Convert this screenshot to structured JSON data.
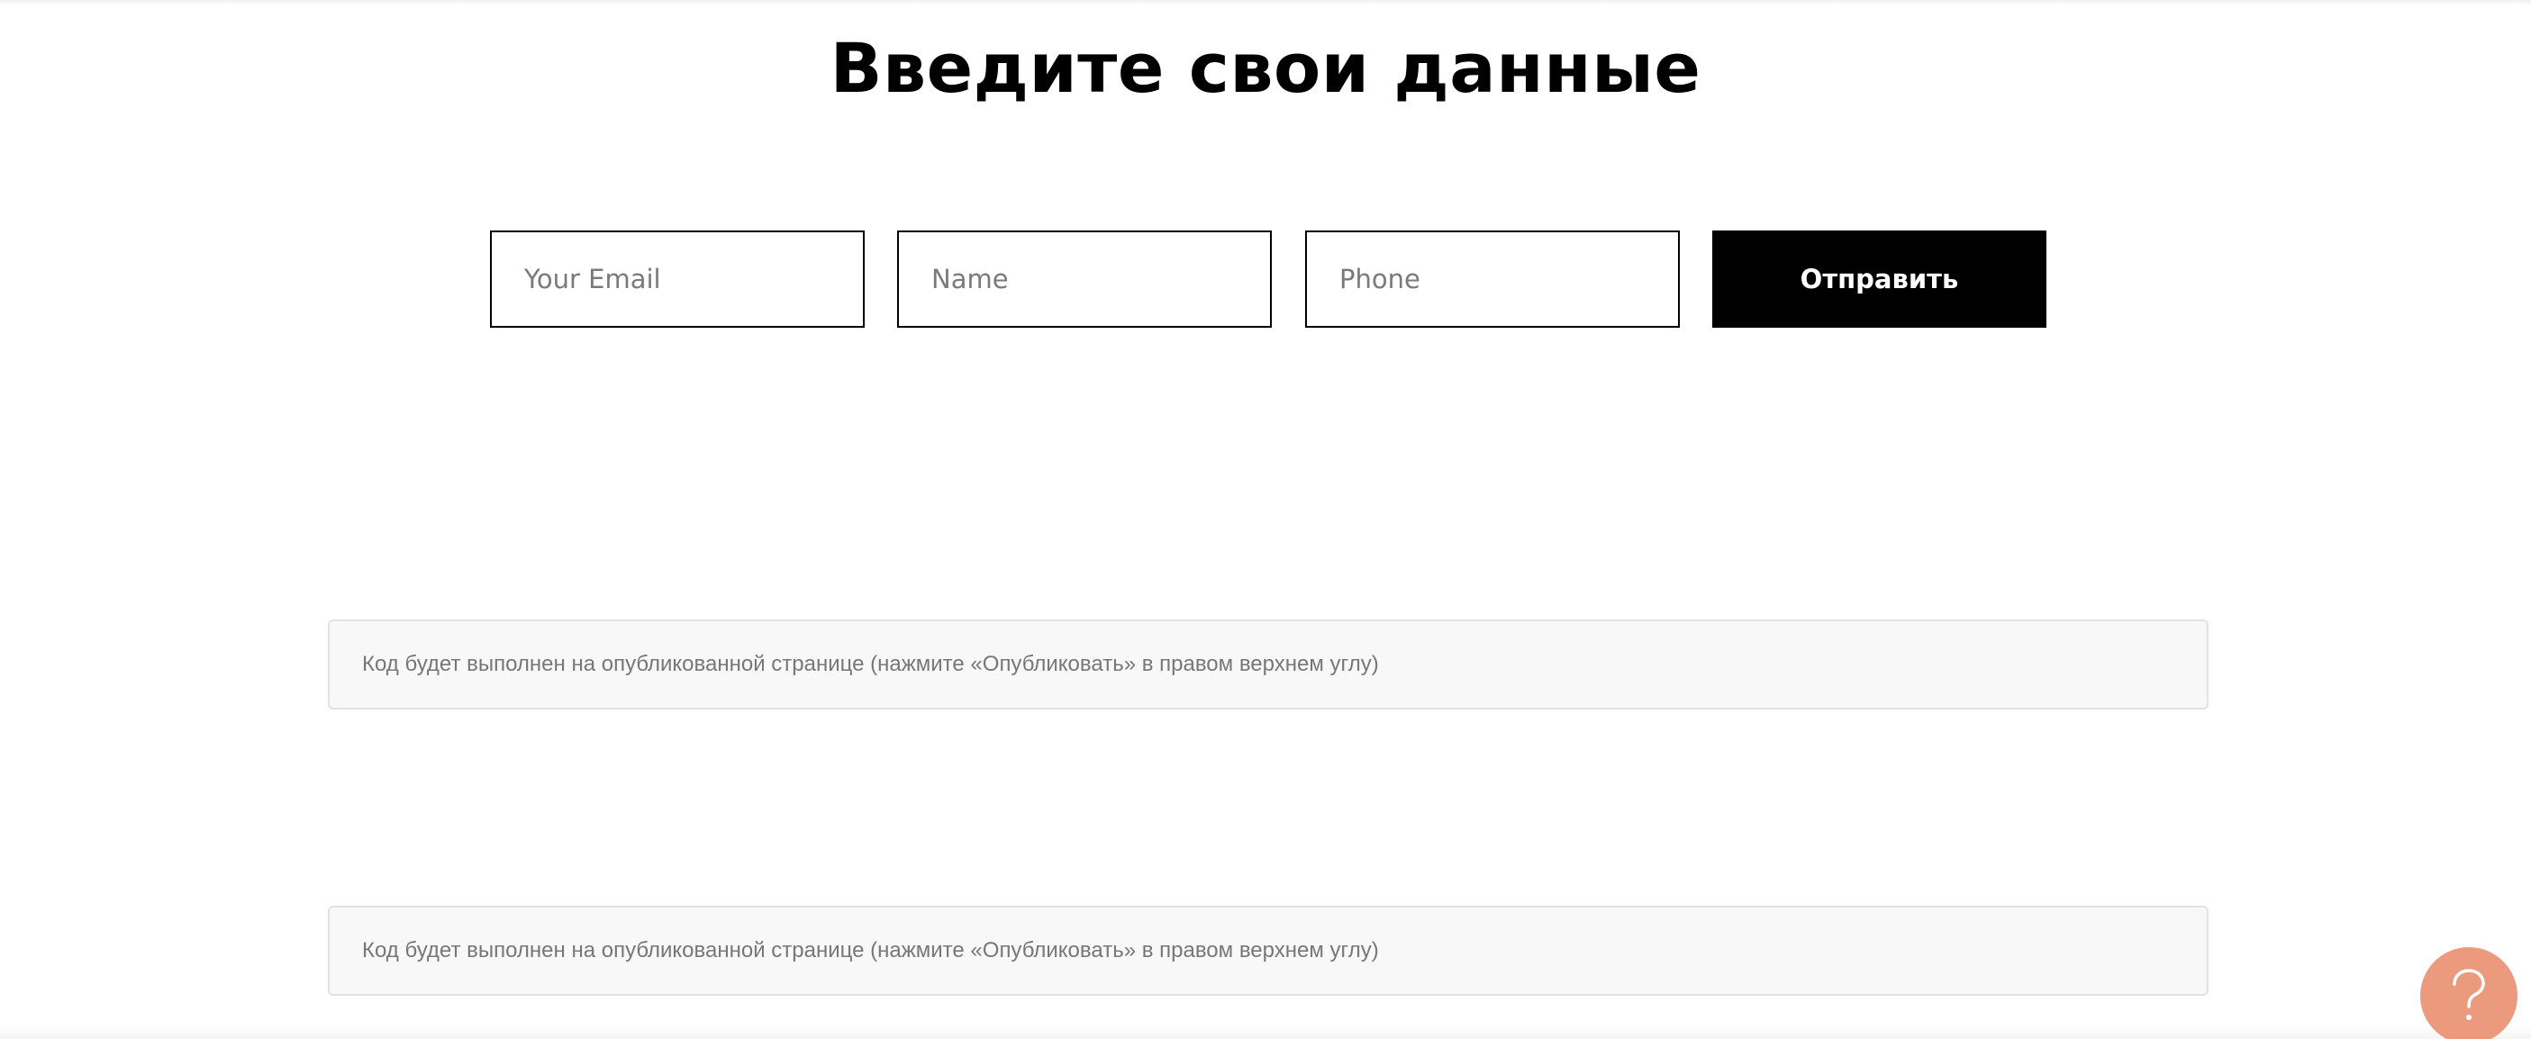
{
  "form": {
    "title": "Введите свои данные",
    "email_placeholder": "Your Email",
    "name_placeholder": "Name",
    "phone_placeholder": "Phone",
    "submit_label": "Отправить"
  },
  "code_blocks": [
    {
      "text": "Код будет выполнен на опубликованной странице (нажмите «Опубликовать» в правом верхнем углу)"
    },
    {
      "text": "Код будет выполнен на опубликованной странице (нажмите «Опубликовать» в правом верхнем углу)"
    }
  ],
  "help_widget": {
    "icon": "question-mark-icon",
    "color": "#ec9a7e"
  }
}
